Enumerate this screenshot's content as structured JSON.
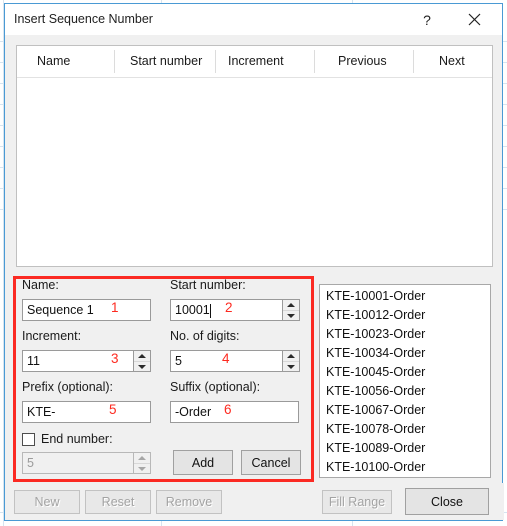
{
  "window": {
    "title": "Insert Sequence Number",
    "help_icon": "question-mark-icon",
    "close_icon": "close-x-icon"
  },
  "table": {
    "columns": [
      "Name",
      "Start number",
      "Increment",
      "Previous",
      "Next"
    ],
    "rows": []
  },
  "form": {
    "name": {
      "label": "Name:",
      "value": "Sequence 1",
      "annotation": "1"
    },
    "start_number": {
      "label": "Start number:",
      "value": "10001",
      "annotation": "2",
      "focused": true
    },
    "increment": {
      "label": "Increment:",
      "value": "11",
      "annotation": "3"
    },
    "digits": {
      "label": "No. of digits:",
      "value": "5",
      "annotation": "4"
    },
    "prefix": {
      "label": "Prefix (optional):",
      "value": "KTE-",
      "annotation": "5"
    },
    "suffix": {
      "label": "Suffix (optional):",
      "value": "-Order",
      "annotation": "6"
    },
    "end_number": {
      "label": "End number:",
      "value": "5",
      "checked": false,
      "enabled": false
    },
    "add_label": "Add",
    "cancel_label": "Cancel"
  },
  "preview": {
    "items": [
      "KTE-10001-Order",
      "KTE-10012-Order",
      "KTE-10023-Order",
      "KTE-10034-Order",
      "KTE-10045-Order",
      "KTE-10056-Order",
      "KTE-10067-Order",
      "KTE-10078-Order",
      "KTE-10089-Order",
      "KTE-10100-Order"
    ]
  },
  "bottom_bar": {
    "new_label": "New",
    "reset_label": "Reset",
    "remove_label": "Remove",
    "fill_range_label": "Fill Range",
    "close_label": "Close"
  },
  "colors": {
    "annotation_red": "#fd2a20",
    "window_border": "#4a9ad4",
    "dialog_background": "#f0f0f0"
  }
}
